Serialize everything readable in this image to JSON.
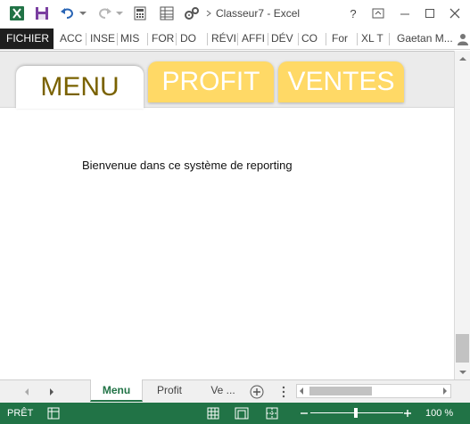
{
  "window": {
    "title": "Classeur7 - Excel",
    "help_label": "?",
    "user_name": "Gaetan M..."
  },
  "ribbon": {
    "tabs": [
      {
        "label": "FICHIER"
      },
      {
        "label": "ACC"
      },
      {
        "label": "INSE"
      },
      {
        "label": "MIS"
      },
      {
        "label": "FOR"
      },
      {
        "label": "DO"
      },
      {
        "label": "RÉVI"
      },
      {
        "label": "AFFI"
      },
      {
        "label": "DÉV"
      },
      {
        "label": "CO"
      },
      {
        "label": "For"
      },
      {
        "label": "XL T"
      }
    ]
  },
  "sheet": {
    "nav_tabs": [
      {
        "label": "MENU"
      },
      {
        "label": "PROFIT"
      },
      {
        "label": "VENTES"
      }
    ],
    "welcome_text": "Bienvenue dans ce système de reporting"
  },
  "sheet_tabs": {
    "tabs": [
      {
        "label": "Menu"
      },
      {
        "label": "Profit"
      },
      {
        "label": "Ve ..."
      }
    ]
  },
  "status_bar": {
    "ready_text": "PRÊT",
    "zoom_label": "100 %",
    "zoom_percent": 100
  },
  "colors": {
    "excel_green": "#217346",
    "nav_tab_yellow": "#ffd966",
    "active_nav_text": "#7a6200"
  }
}
